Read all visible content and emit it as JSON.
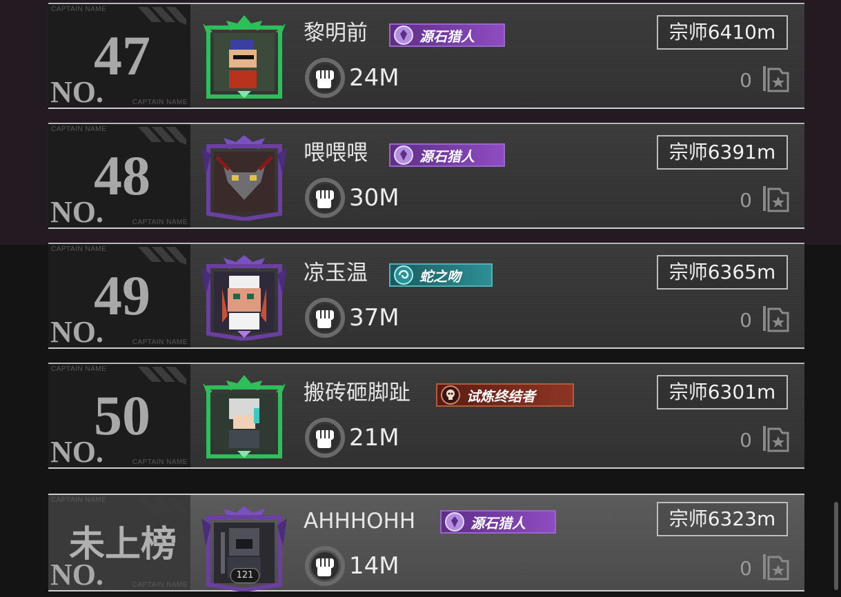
{
  "caption_label": "CAPTAIN NAME",
  "no_label": "NO.",
  "entries": [
    {
      "rank": "47",
      "name": "黎明前",
      "title": "源石猎人",
      "title_style": "purple",
      "frame": "green",
      "power": "24M",
      "score": "宗师6410m",
      "likes": "0"
    },
    {
      "rank": "48",
      "name": "喂喂喂",
      "title": "源石猎人",
      "title_style": "purple",
      "frame": "purple",
      "power": "30M",
      "score": "宗师6391m",
      "likes": "0"
    },
    {
      "rank": "49",
      "name": "凉玉温",
      "title": "蛇之吻",
      "title_style": "teal",
      "frame": "purple",
      "power": "37M",
      "score": "宗师6365m",
      "likes": "0"
    },
    {
      "rank": "50",
      "name": "搬砖砸脚趾",
      "title": "试炼终结者",
      "title_style": "red",
      "frame": "green",
      "power": "21M",
      "score": "宗师6301m",
      "likes": "0"
    },
    {
      "rank_text": "未上榜",
      "name": "AHHHOHH",
      "title": "源石猎人",
      "title_style": "purple",
      "frame": "purple",
      "power": "14M",
      "score": "宗师6323m",
      "likes": "0",
      "level": "121"
    }
  ],
  "colors": {
    "green_frame": "#2fbf5a",
    "purple_frame": "#6a3fa0",
    "accent_purple": "#8e4cc2",
    "accent_teal": "#2c8f95",
    "accent_red": "#8e3524"
  }
}
